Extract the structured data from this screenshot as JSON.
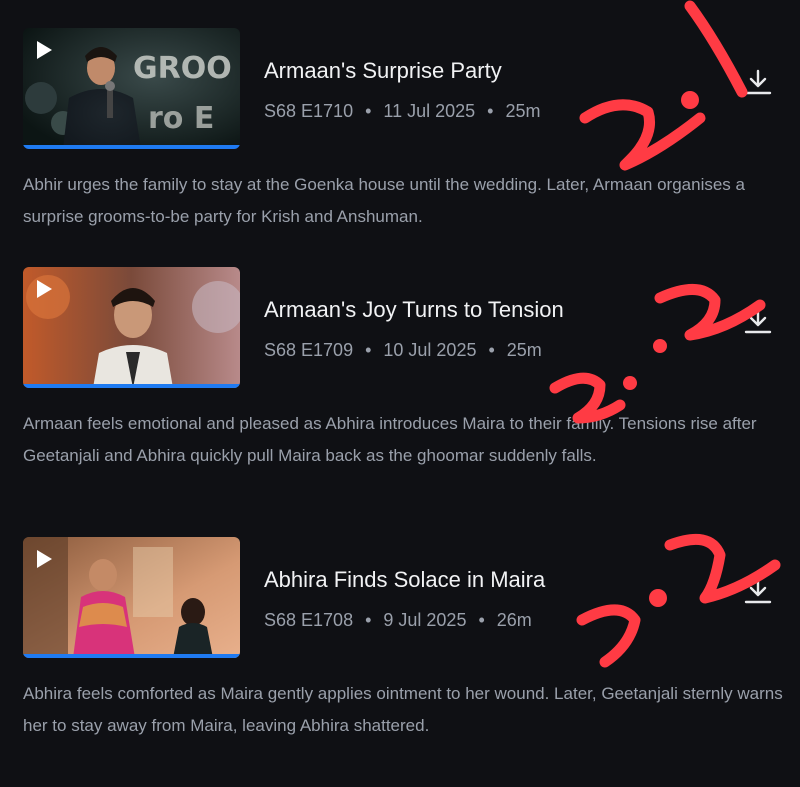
{
  "episodes": [
    {
      "title": "Armaan's Surprise Party",
      "code": "S68 E1710",
      "date": "11 Jul 2025",
      "duration": "25m",
      "description": "Abhir urges the family to stay at the Goenka house until the wedding. Later, Armaan organises a surprise grooms-to-be party for Krish and Anshuman.",
      "thumbnail_text": "GROO ro E",
      "watched_fraction": 1.0
    },
    {
      "title": "Armaan's Joy Turns to Tension",
      "code": "S68 E1709",
      "date": "10 Jul 2025",
      "duration": "25m",
      "description": "Armaan feels emotional and pleased as Abhira introduces Maira to their family. Tensions rise after Geetanjali and Abhira quickly pull Maira back as the ghoomar suddenly falls.",
      "watched_fraction": 1.0
    },
    {
      "title": "Abhira Finds Solace in Maira",
      "code": "S68 E1708",
      "date": "9 Jul 2025",
      "duration": "26m",
      "description": "Abhira feels comforted as Maira gently applies ointment to her wound. Later, Geetanjali sternly warns her to stay away from Maira, leaving Abhira shattered.",
      "watched_fraction": 1.0
    }
  ],
  "separator": "•",
  "colors": {
    "background": "#0f1014",
    "progress": "#1f7bf2",
    "annotation": "#ff3b44"
  },
  "icons": {
    "play": "play-icon",
    "download": "download-icon"
  }
}
